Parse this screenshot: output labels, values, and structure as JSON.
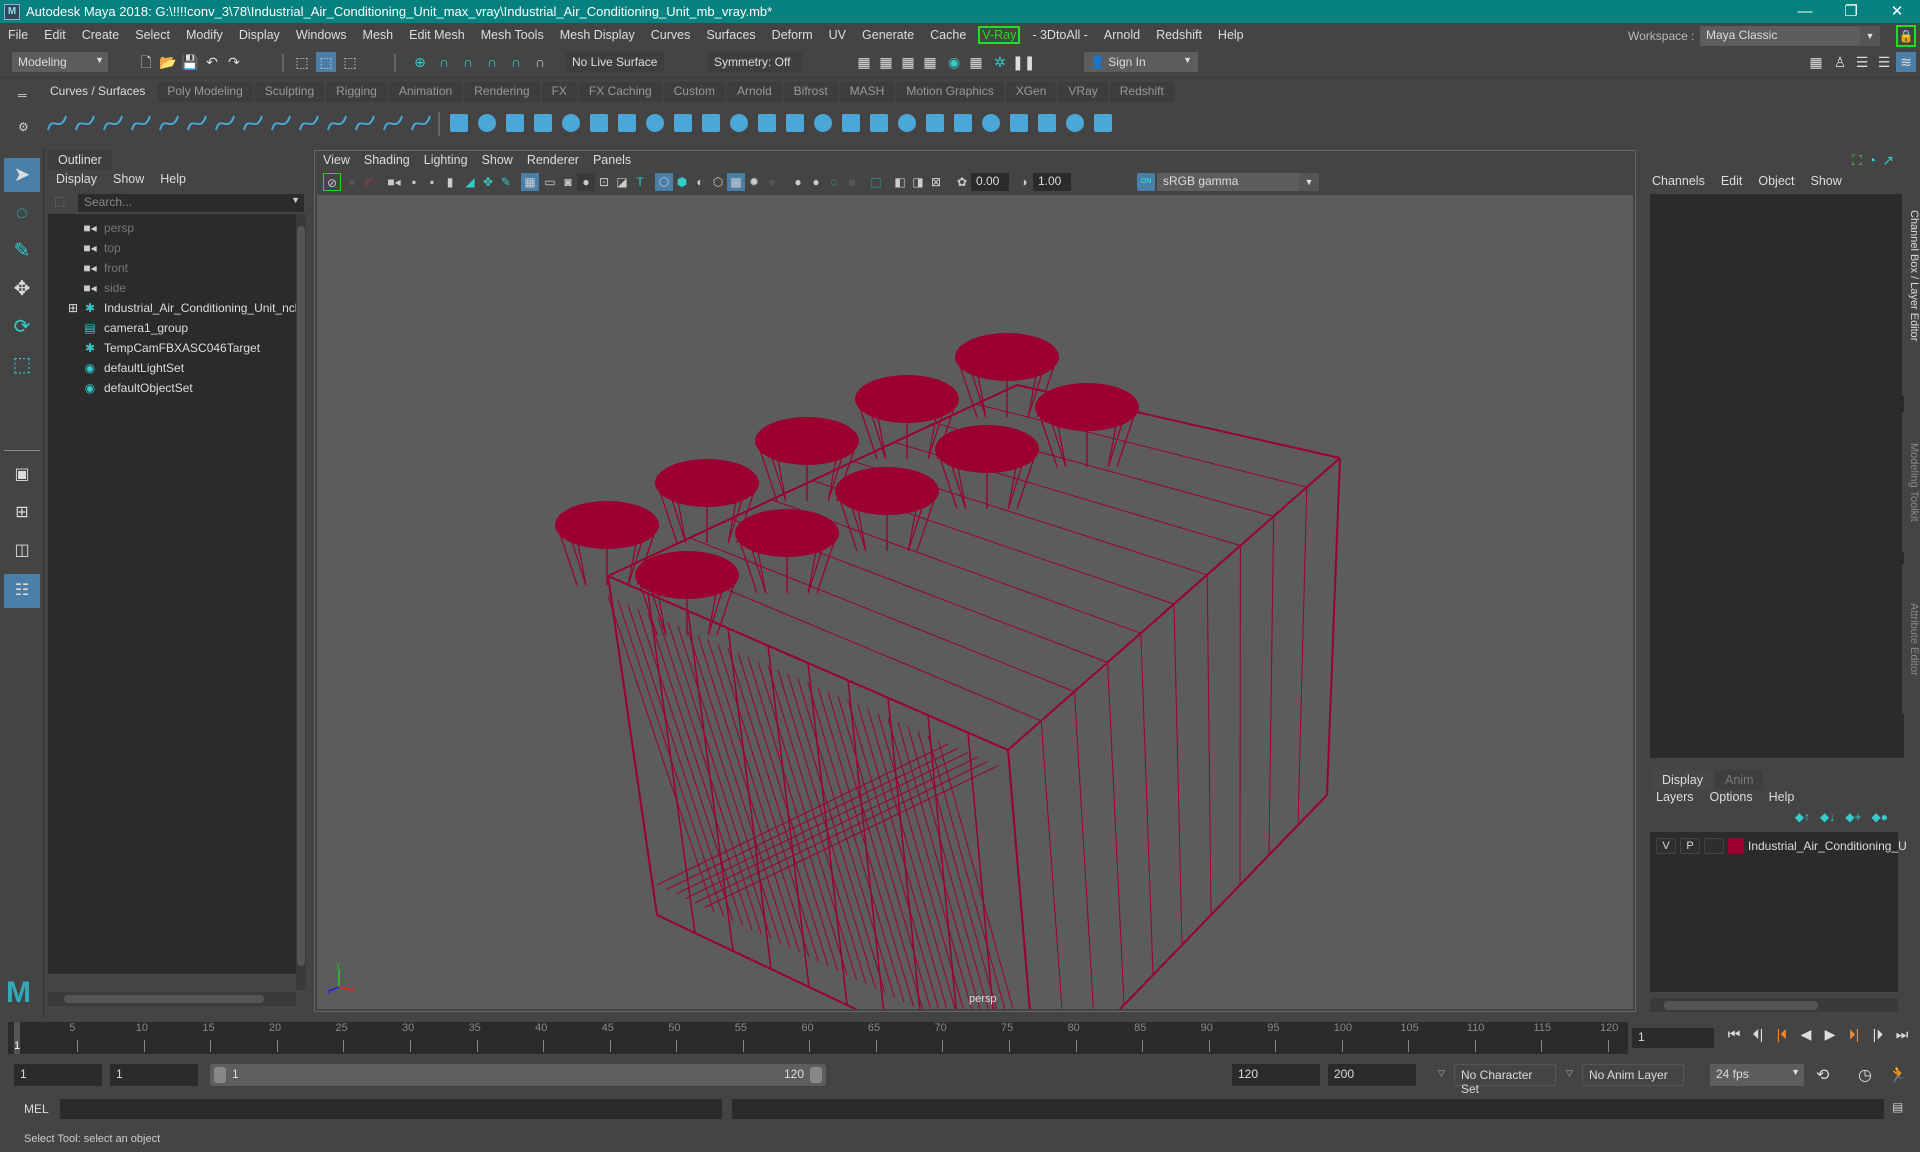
{
  "window": {
    "title": "Autodesk Maya 2018: G:\\!!!!conv_3\\78\\Industrial_Air_Conditioning_Unit_max_vray\\Industrial_Air_Conditioning_Unit_mb_vray.mb*",
    "logo": "M",
    "controls": {
      "minimize": "—",
      "restore": "❐",
      "close": "✕"
    }
  },
  "menubar": [
    "File",
    "Edit",
    "Create",
    "Select",
    "Modify",
    "Display",
    "Windows",
    "Mesh",
    "Edit Mesh",
    "Mesh Tools",
    "Mesh Display",
    "Curves",
    "Surfaces",
    "Deform",
    "UV",
    "Generate",
    "Cache",
    "V-Ray",
    "- 3DtoAll -",
    "Arnold",
    "Redshift",
    "Help"
  ],
  "workspace": {
    "label": "Workspace :",
    "value": "Maya Classic"
  },
  "statusline": {
    "mode": "Modeling",
    "live_surface": "No Live Surface",
    "symmetry": "Symmetry: Off",
    "sign_in": "Sign In"
  },
  "shelf": {
    "tabs": [
      "Curves / Surfaces",
      "Poly Modeling",
      "Sculpting",
      "Rigging",
      "Animation",
      "Rendering",
      "FX",
      "FX Caching",
      "Custom",
      "Arnold",
      "Bifrost",
      "MASH",
      "Motion Graphics",
      "XGen",
      "VRay",
      "Redshift"
    ],
    "active_tab": "Curves / Surfaces",
    "icon_names": [
      "nurbs-circle",
      "nurbs-square",
      "ep-curve",
      "pencil-curve",
      "cv-curve",
      "bezier-curve",
      "cut-curve",
      "attach-curve",
      "extend-curve",
      "offset-curve",
      "duplicate-curve",
      "curve-points",
      "project-curve",
      "rebuild-curve",
      "nurbs-sphere",
      "nurbs-cube",
      "nurbs-cylinder",
      "nurbs-cone",
      "nurbs-plane",
      "nurbs-torus",
      "revolve",
      "loft",
      "planar",
      "extrude",
      "birail",
      "boundary",
      "square-surface",
      "bevel",
      "intersect",
      "trim",
      "untrim",
      "attach-surface",
      "detach",
      "insert-isoparm",
      "rebuild-surface",
      "stitch",
      "sculpt-geometry",
      "surface-fillet"
    ]
  },
  "toolbox": {
    "tools": [
      "select-tool",
      "lasso-tool",
      "paint-select-tool",
      "move-tool",
      "rotate-tool",
      "scale-tool"
    ],
    "layouts": [
      "single-view",
      "four-view",
      "two-view",
      "outliner-layout"
    ]
  },
  "outliner": {
    "title": "Outliner",
    "menu": [
      "Display",
      "Show",
      "Help"
    ],
    "search_placeholder": "Search...",
    "items": [
      {
        "label": "persp",
        "icon": "camera-icon",
        "dim": true
      },
      {
        "label": "top",
        "icon": "camera-icon",
        "dim": true
      },
      {
        "label": "front",
        "icon": "camera-icon",
        "dim": true
      },
      {
        "label": "side",
        "icon": "camera-icon",
        "dim": true
      },
      {
        "label": "Industrial_Air_Conditioning_Unit_ncl",
        "icon": "transform-icon",
        "expandable": true
      },
      {
        "label": "camera1_group",
        "icon": "group-icon"
      },
      {
        "label": "TempCamFBXASC046Target",
        "icon": "transform-icon"
      },
      {
        "label": "defaultLightSet",
        "icon": "set-icon"
      },
      {
        "label": "defaultObjectSet",
        "icon": "set-icon"
      }
    ]
  },
  "viewport": {
    "menu": [
      "View",
      "Shading",
      "Lighting",
      "Show",
      "Renderer",
      "Panels"
    ],
    "exposure": "0.00",
    "gamma": "1.00",
    "color_space_toggle": "ON",
    "color_space": "sRGB gamma",
    "camera_label": "persp",
    "axis": {
      "x": "x",
      "y": "y",
      "z": "z"
    },
    "wireframe_color": "#9b0030"
  },
  "channel_box": {
    "menu": [
      "Channels",
      "Edit",
      "Object",
      "Show"
    ]
  },
  "layer_editor": {
    "tabs": [
      "Display",
      "Anim"
    ],
    "active_tab": "Display",
    "menu": [
      "Layers",
      "Options",
      "Help"
    ],
    "layers": [
      {
        "visible": "V",
        "playback": "P",
        "color": "#9b0030",
        "name": "Industrial_Air_Conditioning_U"
      }
    ]
  },
  "side_tabs": [
    "Channel Box / Layer Editor",
    "Modeling Toolkit",
    "Attribute Editor"
  ],
  "timeline": {
    "start": 1,
    "end": 120,
    "ticks": [
      5,
      10,
      15,
      20,
      25,
      30,
      35,
      40,
      45,
      50,
      55,
      60,
      65,
      70,
      75,
      80,
      85,
      90,
      95,
      100,
      105,
      110,
      115,
      120
    ],
    "current_frame": "1",
    "frame_field": "1"
  },
  "range": {
    "start_time": "1",
    "playback_start": "1",
    "range_start_label": "1",
    "range_end_label": "120",
    "playback_end": "120",
    "end_time": "200",
    "character_set": "No Character Set",
    "anim_layer": "No Anim Layer",
    "fps": "24 fps"
  },
  "command": {
    "label": "MEL"
  },
  "help_line": "Select Tool: select an object"
}
